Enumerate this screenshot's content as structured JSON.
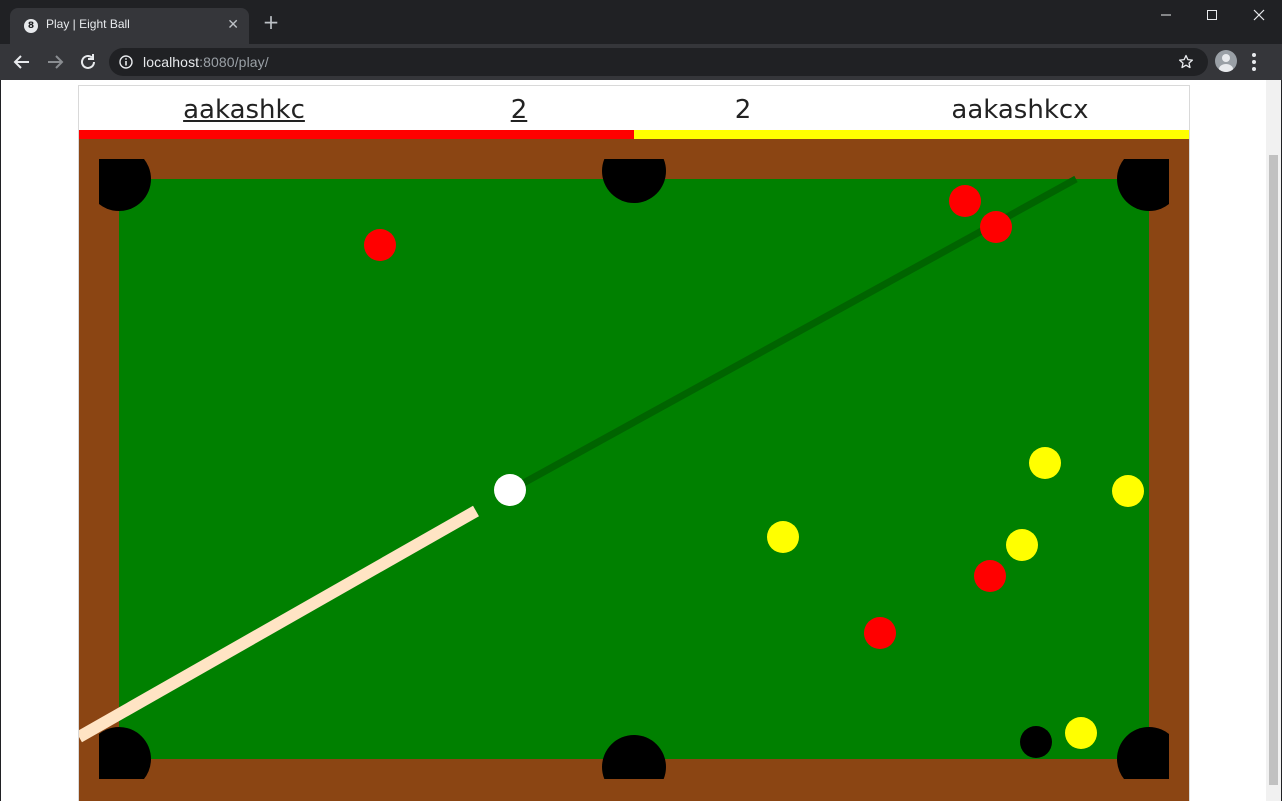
{
  "browser": {
    "tab": {
      "title": "Play | Eight Ball",
      "favicon": "eight-ball-icon",
      "favicon_glyph": "8",
      "close_glyph": "✕"
    },
    "new_tab_glyph": "+",
    "url_host": "localhost",
    "url_path": ":8080/play/"
  },
  "scoreboard": {
    "player1": {
      "name": "aakashkc",
      "score": "2",
      "color": "#ff0000",
      "active": true
    },
    "player2": {
      "name": "aakashkcx",
      "score": "2",
      "color": "#ffff00",
      "active": false
    }
  },
  "colors": {
    "rail": "#8b4513",
    "felt": "#008000",
    "pocket": "#000000",
    "cue_stick": "#ffe4c4",
    "aim_line": "#006400",
    "red_ball": "#ff0000",
    "yellow_ball": "#ffff00",
    "cue_ball": "#ffffff",
    "eight_ball": "#000000"
  }
}
